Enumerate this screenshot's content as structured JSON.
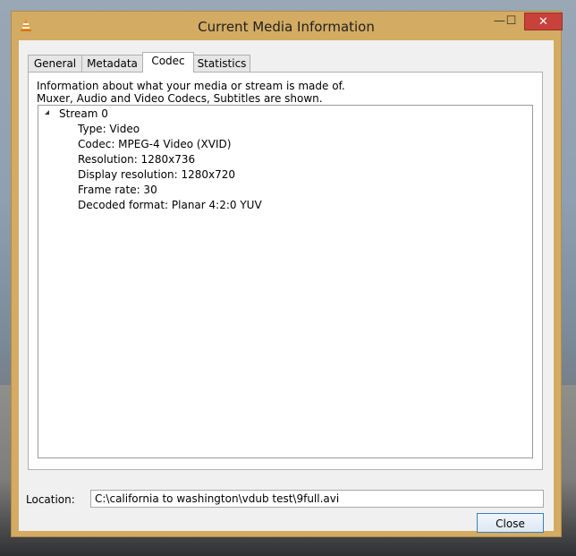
{
  "window": {
    "title": "Current Media Information",
    "controls": {
      "minimize": "—",
      "maximize": "☐",
      "close": "✕"
    }
  },
  "tabs": [
    {
      "label": "General"
    },
    {
      "label": "Metadata"
    },
    {
      "label": "Codec",
      "active": true
    },
    {
      "label": "Statistics"
    }
  ],
  "codec": {
    "description_line1": "Information about what your media or stream is made of.",
    "description_line2": "Muxer, Audio and Video Codecs, Subtitles are shown.",
    "stream": {
      "label": "Stream 0",
      "properties": [
        "Type: Video",
        "Codec: MPEG-4 Video (XVID)",
        "Resolution: 1280x736",
        "Display resolution: 1280x720",
        "Frame rate: 30",
        "Decoded format: Planar 4:2:0 YUV"
      ]
    }
  },
  "location": {
    "label": "Location:",
    "value": "C:\\california to washington\\vdub test\\9full.avi"
  },
  "buttons": {
    "close": "Close"
  },
  "icons": {
    "app": "vlc-cone-icon",
    "expander": "tree-expanded-icon"
  },
  "colors": {
    "frame": "#d3ab62",
    "close_button": "#c7423a",
    "focus_border": "#3c7fb1"
  }
}
